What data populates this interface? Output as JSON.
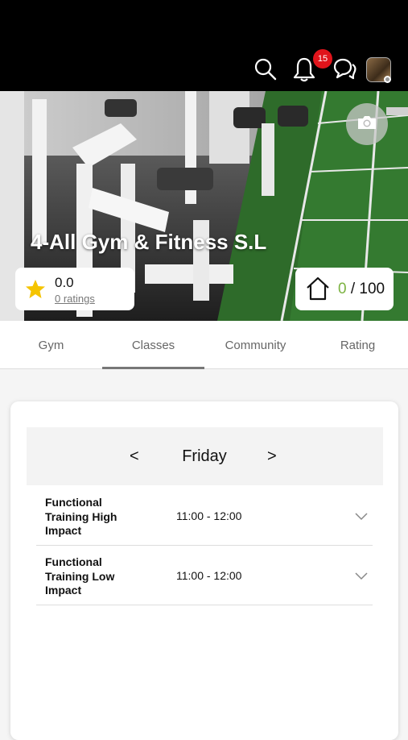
{
  "header": {
    "notification_count": "15",
    "icons": [
      "search-icon",
      "bell-icon",
      "chat-icon",
      "avatar"
    ]
  },
  "gym": {
    "name": "4-All Gym & Fitness S.L",
    "rating_value": "0.0",
    "rating_count": "0 ratings",
    "points_current": "0",
    "points_total": " / 100"
  },
  "tabs": [
    {
      "label": "Gym"
    },
    {
      "label": "Classes",
      "active": true
    },
    {
      "label": "Community"
    },
    {
      "label": "Rating"
    }
  ],
  "schedule": {
    "prev": "<",
    "day": "Friday",
    "next": ">",
    "classes": [
      {
        "name": "Functional Training High Impact",
        "time": "11:00 - 12:00"
      },
      {
        "name": "Functional Training Low Impact",
        "time": "11:00 - 12:00"
      }
    ]
  },
  "colors": {
    "badge": "#e0141b",
    "points_accent": "#7cb342",
    "star": "#f5c400"
  }
}
